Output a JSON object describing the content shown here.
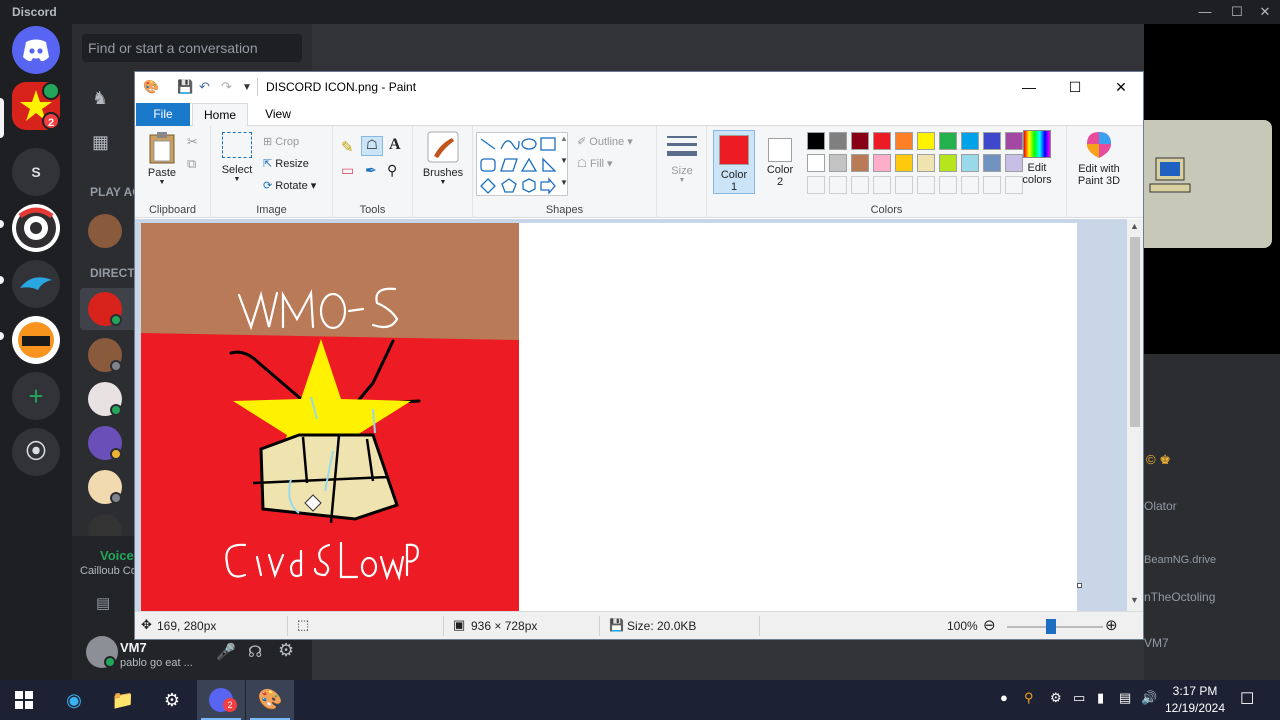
{
  "discord": {
    "app_name": "Discord",
    "search_placeholder": "Find or start a conversation",
    "server_letter": "S",
    "server_badge": "2",
    "play_again_label": "PLAY AG",
    "direct_label": "DIRECT",
    "voice_status": "Voice",
    "voice_channel": "Cailloub Co",
    "user_name": "VM7",
    "user_status": "pablo go eat ...",
    "right_text_1": "Olator",
    "right_text_2": "BeamNG.drive",
    "right_text_3": "nTheOctoling",
    "right_text_4": "VM7"
  },
  "paint": {
    "title": "DISCORD ICON.png - Paint",
    "tabs": {
      "file": "File",
      "home": "Home",
      "view": "View"
    },
    "help": "?",
    "groups": {
      "clipboard": "Clipboard",
      "image": "Image",
      "tools": "Tools",
      "shapes": "Shapes",
      "colors": "Colors"
    },
    "buttons": {
      "paste": "Paste",
      "select": "Select",
      "crop": "Crop",
      "resize": "Resize",
      "rotate": "Rotate",
      "brushes": "Brushes",
      "outline": "Outline",
      "fill": "Fill",
      "size": "Size",
      "color1_line1": "Color",
      "color1_line2": "1",
      "color2_line1": "Color",
      "color2_line2": "2",
      "edit_colors_line1": "Edit",
      "edit_colors_line2": "colors",
      "edit_3d_line1": "Edit with",
      "edit_3d_line2": "Paint 3D"
    },
    "color1": "#ed1c24",
    "color2": "#ffffff",
    "palette_row1": [
      "#000000",
      "#7f7f7f",
      "#880015",
      "#ed1c24",
      "#ff7f27",
      "#fff200",
      "#22b14c",
      "#00a2e8",
      "#3f48cc",
      "#a349a4"
    ],
    "palette_row2": [
      "#ffffff",
      "#c3c3c3",
      "#b97a57",
      "#ffaec9",
      "#ffc90e",
      "#efe4b0",
      "#b5e61d",
      "#99d9ea",
      "#7092be",
      "#c8bfe7"
    ],
    "status": {
      "cursor": "169, 280px",
      "dimensions": "936 × 728px",
      "size": "Size: 20.0KB",
      "zoom": "100%"
    },
    "zoom_percent": 100,
    "drawing": {
      "top_text": "VMO-S",
      "bottom_text": "CivdsB Lowp",
      "colors": {
        "top_band": "#b97a57",
        "background": "#ed1c24",
        "star": "#fff200",
        "lamp": "#efe4b0"
      }
    }
  },
  "taskbar": {
    "time": "3:17 PM",
    "date": "12/19/2024",
    "discord_badge": "2"
  }
}
